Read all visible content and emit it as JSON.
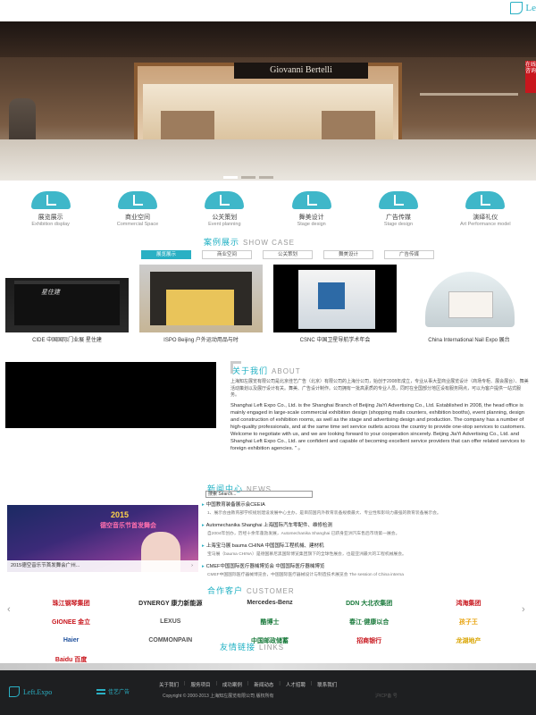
{
  "header": {
    "logo_text": "Le"
  },
  "hero": {
    "sign": "Giovanni Bertelli",
    "side_tab": "在线咨询"
  },
  "services": [
    {
      "cn": "展览展示",
      "en": "Exhibition display"
    },
    {
      "cn": "商业空间",
      "en": "Commercial Space"
    },
    {
      "cn": "公关策划",
      "en": "Event planning"
    },
    {
      "cn": "舞美设计",
      "en": "Stage design"
    },
    {
      "cn": "广告传媒",
      "en": "Stage design"
    },
    {
      "cn": "演绎礼仪",
      "en": "Art Performance model"
    }
  ],
  "showcase": {
    "title": "案例展示",
    "title_en": "SHOW CASE",
    "tabs": [
      "展览展示",
      "商业空间",
      "公关策划",
      "舞美设计",
      "广告传媒"
    ],
    "cases": [
      {
        "caption": "CIDE 中国国际门业展 星住建",
        "logo": "星住建"
      },
      {
        "caption": "ISPO Beijing 户外运动用品与时",
        "logo": ""
      },
      {
        "caption": "CSNC 中国卫星导航学术年会",
        "logo": ""
      },
      {
        "caption": "China International Nail Expo 展台",
        "logo": ""
      }
    ]
  },
  "about": {
    "title": "关于我们",
    "title_en": "ABOUT",
    "text_cn": "上海知左展览有限公司是北京佳艺广告（北京）有限公司的上海分公司，始创于2008年成立，专业从事大型商业展览设计（商场专柜、展会展台）、舞美活动策划以及展厅设计有关。舞美、广告设计制作。公司拥有一批高素质的专业人员，同时在全国部分地区设有服务网点，可以为客户提供一站式服务。",
    "text_en": "Shanghai Left Expo Co., Ltd. is the Shanghai Branch of Beijing JiaYi Advertising Co., Ltd. Established in 2008, the head office is mainly engaged in large-scale commercial exhibition design (shopping malls counters, exhibition booths), event planning, design and construction of exhibition rooms, as well as the stage and advertising design and production. The company has a number of high-quality professionals, and at the same time set service outlets across the country to provide one-stop services to customers. Welcome to negotiate with us, and we are looking forward to your cooperation sincerely.     Beijing JiaYi Advertising Co., Ltd. and Shanghai Left Expo Co., Ltd. are confident and capable of becoming excellent service providers that can offer related services to foreign exhibition agencies. \" 。"
  },
  "news": {
    "title": "新闻中心",
    "title_en": "NEWS",
    "search_label": "搜索",
    "search_placeholder": "Search...",
    "feature_caption": "2015德空音乐节首发舞会广州...",
    "feature_year": "2015",
    "feature_headline": "德空音乐节首发舞会",
    "items": [
      {
        "headline": "中国教育装备展示会CEEIA",
        "desc": "1、展示会由教育部学校规划建设发展中心主办，是目前国内外教育装备规模最大、专业性和影响力最强的教育装备展示会。"
      },
      {
        "headline": "Automechanika Shanghai 上海国际汽车零配件、维修检测",
        "desc": "自2004年创办，历经十余年蓬勃发展，Automechanika Shanghai 已跻身亚洲汽车售后市场第一展会。"
      },
      {
        "headline": "上海宝马展 bauma CHINA 中国国际工程机械、建材机",
        "desc": "宝马展（bauma CHINA）是德国慕尼黑国际博览集团旗下的全球性展会，也是亚洲最大的工程机械展会。"
      },
      {
        "headline": "CMEF中国国际医疗器械博览会 中国国际医疗器械博览",
        "desc": "CMEF中国国际医疗器械博览会，中国国际医疗器械设计与制造技术展览会  The session of China interna"
      }
    ]
  },
  "customers": {
    "title": "合作客户",
    "title_en": "CUSTOMER",
    "prev": "‹",
    "next": "›",
    "logos": [
      {
        "name": "珠江钢琴集团",
        "color": "#c8161d"
      },
      {
        "name": "DYNERGY 康力新能源",
        "color": "#2b2b2b"
      },
      {
        "name": "Mercedes-Benz",
        "color": "#333333"
      },
      {
        "name": "DDN 大北农集团",
        "color": "#1a7a3c"
      },
      {
        "name": "鸿海集团",
        "color": "#c8161d"
      },
      {
        "name": "GIONEE 金立",
        "color": "#c8161d"
      },
      {
        "name": "LEXUS",
        "color": "#555555"
      },
      {
        "name": "酷博士",
        "color": "#1a7a3c"
      },
      {
        "name": "春江·健康以合",
        "color": "#1a7a3c"
      },
      {
        "name": "孩子王",
        "color": "#e8a30f"
      },
      {
        "name": "Haier",
        "color": "#1d4f9c"
      },
      {
        "name": "COMMONPAIN",
        "color": "#555555"
      },
      {
        "name": "中国邮政储蓄",
        "color": "#1a7a3c"
      },
      {
        "name": "招商银行",
        "color": "#c8161d"
      },
      {
        "name": "龙湖地产",
        "color": "#d9a400"
      },
      {
        "name": "Baidu 百度",
        "color": "#c8161d"
      }
    ]
  },
  "links": {
    "title": "友情链接",
    "title_en": "LINKS"
  },
  "footer": {
    "logo_text": "Left.Expo",
    "brand": "佳艺广告",
    "nav": [
      "关于我们",
      "服务项目",
      "成功案例",
      "新闻动态",
      "人才招聘",
      "联系我们"
    ],
    "copyright": "Copyright © 2000-2013  上海知左展览有限公司 版权所有",
    "faint": "沪ICP备  号"
  },
  "colors": {
    "accent": "#2ab0c4",
    "footer_bg": "#1e1f21",
    "red": "#c8161d"
  }
}
